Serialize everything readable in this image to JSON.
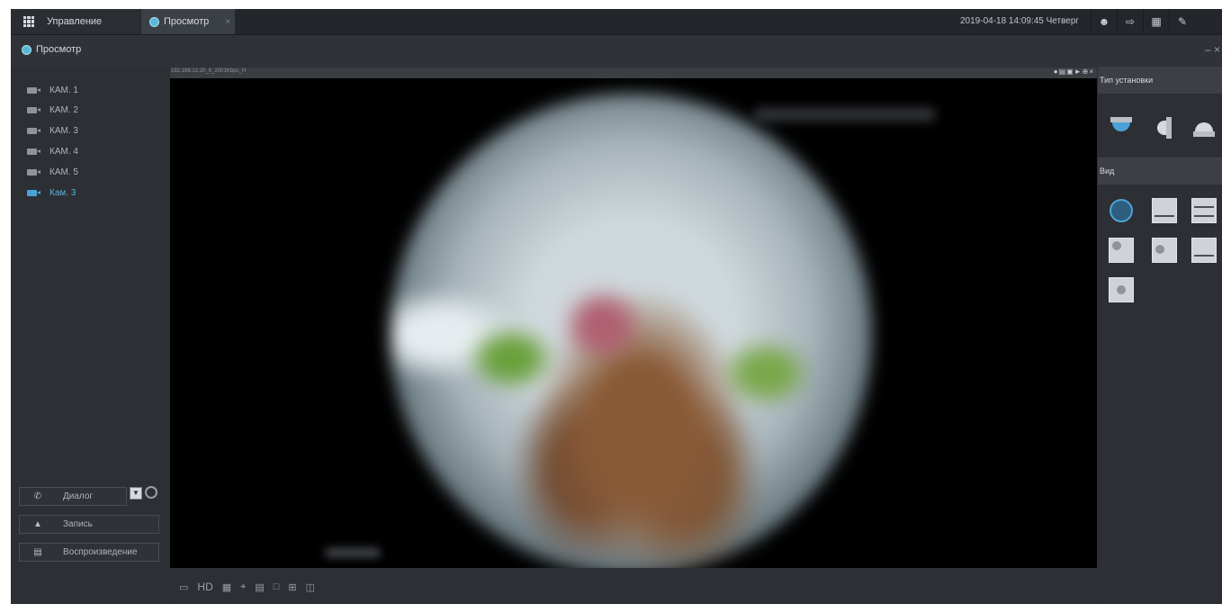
{
  "topbar": {
    "manage_tab": "Управление",
    "view_tab": "Просмотр",
    "close_symbol": "×",
    "datetime": "2019-04-18 14:09:45 Четверг",
    "icons": [
      "user-icon",
      "logout-icon",
      "layout-icon",
      "pin-icon"
    ]
  },
  "titlebar": {
    "title": "Просмотр",
    "minimize": "– ×"
  },
  "cameras": [
    {
      "label": "КАМ. 1",
      "active": false
    },
    {
      "label": "КАМ. 2",
      "active": false
    },
    {
      "label": "КАМ. 3",
      "active": false
    },
    {
      "label": "КАМ. 4",
      "active": false
    },
    {
      "label": "КАМ. 5",
      "active": false
    },
    {
      "label": "Кам. 3",
      "active": true
    }
  ],
  "left_buttons": {
    "dialog": "Диалог",
    "record": "Запись",
    "playback": "Воспроизведение"
  },
  "video": {
    "stream_info": "192.168.12.20_6_2001Kbps_H"
  },
  "video_toolbar": {
    "hd_label": "HD"
  },
  "right_panel": {
    "install_type_title": "Тип установки",
    "view_title": "Вид"
  },
  "colors": {
    "accent": "#4aa3d8",
    "panel": "#2c2f34",
    "header": "#3c4046"
  }
}
